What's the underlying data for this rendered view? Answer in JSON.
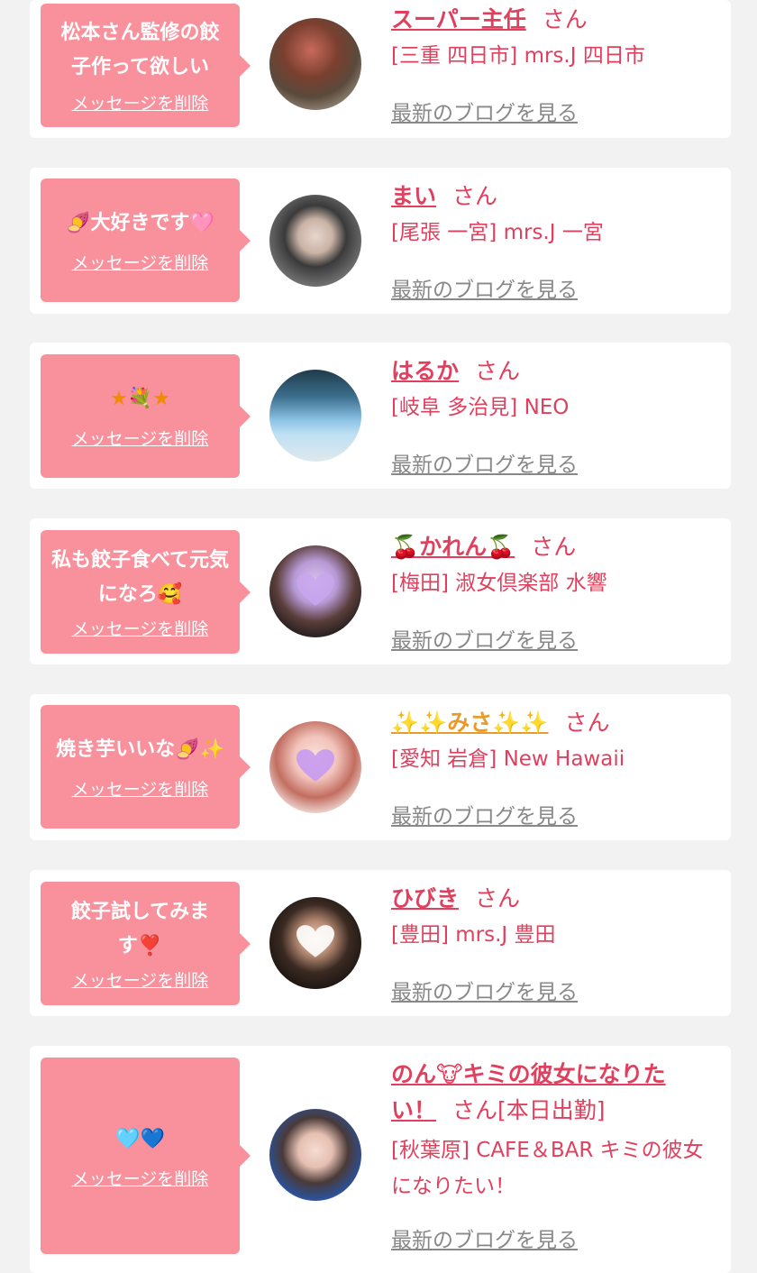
{
  "favorites": [
    {
      "message": "松本さん監修の餃子作って欲しい",
      "delete_label": "メッセージを削除",
      "name": "スーパー主任",
      "honorific": "さん",
      "shop": "[三重 四日市] mrs.J 四日市",
      "blog_label": "最新のブログを見る"
    },
    {
      "message": "🍠大好きです🩷",
      "delete_label": "メッセージを削除",
      "name": "まい",
      "honorific": "さん",
      "shop": "[尾張 一宮] mrs.J 一宮",
      "blog_label": "最新のブログを見る"
    },
    {
      "message": "★💐★",
      "delete_label": "メッセージを削除",
      "name": "はるか",
      "honorific": "さん",
      "shop": "[岐阜 多治見] NEO",
      "blog_label": "最新のブログを見る"
    },
    {
      "message": "私も餃子食べて元気になろ🥰",
      "delete_label": "メッセージを削除",
      "name": "🍒かれん🍒",
      "honorific": "さん",
      "shop": "[梅田] 淑女倶楽部 水響",
      "blog_label": "最新のブログを見る"
    },
    {
      "message": "焼き芋いいな🍠✨",
      "delete_label": "メッセージを削除",
      "name": "✨✨みさ✨✨",
      "honorific": "さん",
      "shop": "[愛知 岩倉] New Hawaii",
      "blog_label": "最新のブログを見る"
    },
    {
      "message": "餃子試してみます❣️",
      "delete_label": "メッセージを削除",
      "name": "ひびき",
      "honorific": "さん",
      "shop": "[豊田] mrs.J 豊田",
      "blog_label": "最新のブログを見る"
    },
    {
      "message": "🩵💙",
      "delete_label": "メッセージを削除",
      "name": "のん🐮キミの彼女になりたい！",
      "honorific": "さん[本日出勤]",
      "shop": "[秋葉原] CAFE＆BAR キミの彼女になりたい！",
      "blog_label": "最新のブログを見る"
    }
  ],
  "colors": {
    "page_bg": "#f2f2f2",
    "bubble_bg": "#f9919d",
    "accent_text": "#e0405e",
    "link_gray": "#888888"
  }
}
